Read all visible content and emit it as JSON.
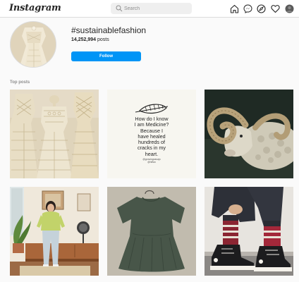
{
  "header": {
    "logo_text": "Instagram",
    "search_placeholder": "Search",
    "icons": [
      "home-icon",
      "messenger-icon",
      "explore-icon",
      "heart-icon",
      "avatar"
    ]
  },
  "hashtag": {
    "title": "#sustainablefashion",
    "post_count": "14,252,994",
    "posts_label": "posts",
    "follow_label": "Follow"
  },
  "sections": {
    "top_posts_label": "Top posts"
  },
  "posts": [
    {
      "subject": "lace-dresses"
    },
    {
      "subject": "quote",
      "quote_lines": [
        "How do I know",
        "I am Medicine?",
        "Because I",
        "have healed",
        "hundreds of",
        "cracks in my",
        "heart."
      ],
      "handle_lines": [
        "@growingnavajo",
        "@hiffan"
      ]
    },
    {
      "subject": "ram-painting"
    },
    {
      "subject": "woman-in-room"
    },
    {
      "subject": "green-dress"
    },
    {
      "subject": "sneakers-socks"
    }
  ],
  "colors": {
    "accent": "#0095f6",
    "text": "#262626",
    "muted": "#8e8e8e",
    "background": "#fafafa"
  }
}
